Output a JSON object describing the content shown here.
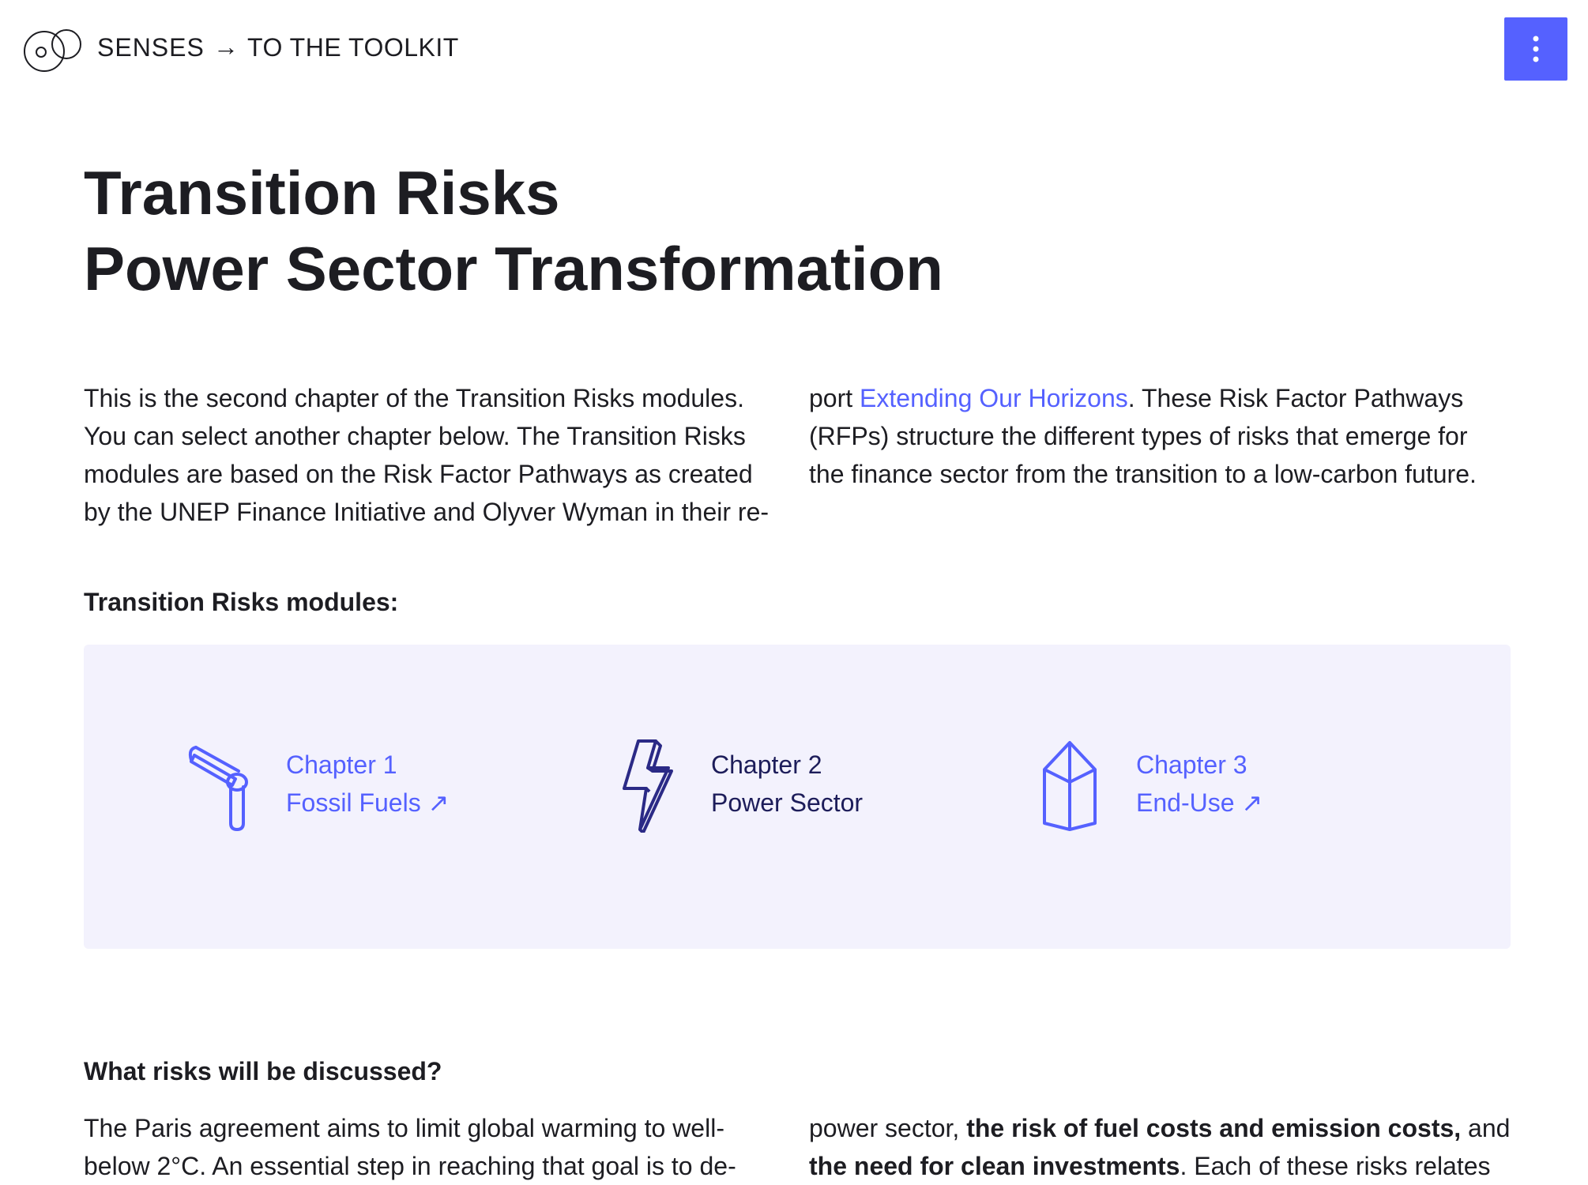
{
  "header": {
    "brand": "SENSES",
    "arrow": "→",
    "toolkit_link": "TO THE TOOLKIT",
    "menu_icon": "vertical-dots-icon",
    "accent": "#5561ff"
  },
  "title": {
    "line1": "Transition Risks",
    "line2": "Power Sector Transformation"
  },
  "intro": {
    "left_lines": [
      "This is the second chapter of the Transition Risks modules.",
      "You can select another chapter below. The Transition Risks",
      "modules are based on the Risk Factor Pathways as created",
      "by the UNEP Finance Initiative and Olyver Wyman in their re-"
    ],
    "right_prefix": "port ",
    "right_link": "Extending Our Horizons",
    "right_line1_suffix": ". These Risk Factor Pathways",
    "right_line2": "(RFPs) structure the different types of risks that emerge for",
    "right_line3": "the finance sector from the transition to a low-carbon future."
  },
  "modules_heading": "Transition Risks modules:",
  "chapters": [
    {
      "label": "Chapter 1",
      "name": "Fossil Fuels ↗",
      "icon": "pipe-icon",
      "active": false
    },
    {
      "label": "Chapter 2",
      "name": "Power Sector",
      "icon": "lightning-bolt-icon",
      "active": true
    },
    {
      "label": "Chapter 3",
      "name": "End-Use ↗",
      "icon": "house-icon",
      "active": false
    }
  ],
  "risks_heading": "What risks will be discussed?",
  "risks": {
    "left_line1": "The Paris agreement aims to limit global warming to well-",
    "left_line2": "below 2°C. An essential step in reaching that goal is to de-",
    "right_line1_prefix": "power sector, ",
    "right_line1_bold": "the risk of fuel costs and emission costs,",
    "right_line1_suffix": " and",
    "right_line2_bold": "the need for clean investments",
    "right_line2_suffix": ". Each of these risks relates"
  },
  "colors": {
    "panel_bg": "#f3f2fd",
    "text": "#1d1d22",
    "active_chapter": "#1d1d5a"
  }
}
